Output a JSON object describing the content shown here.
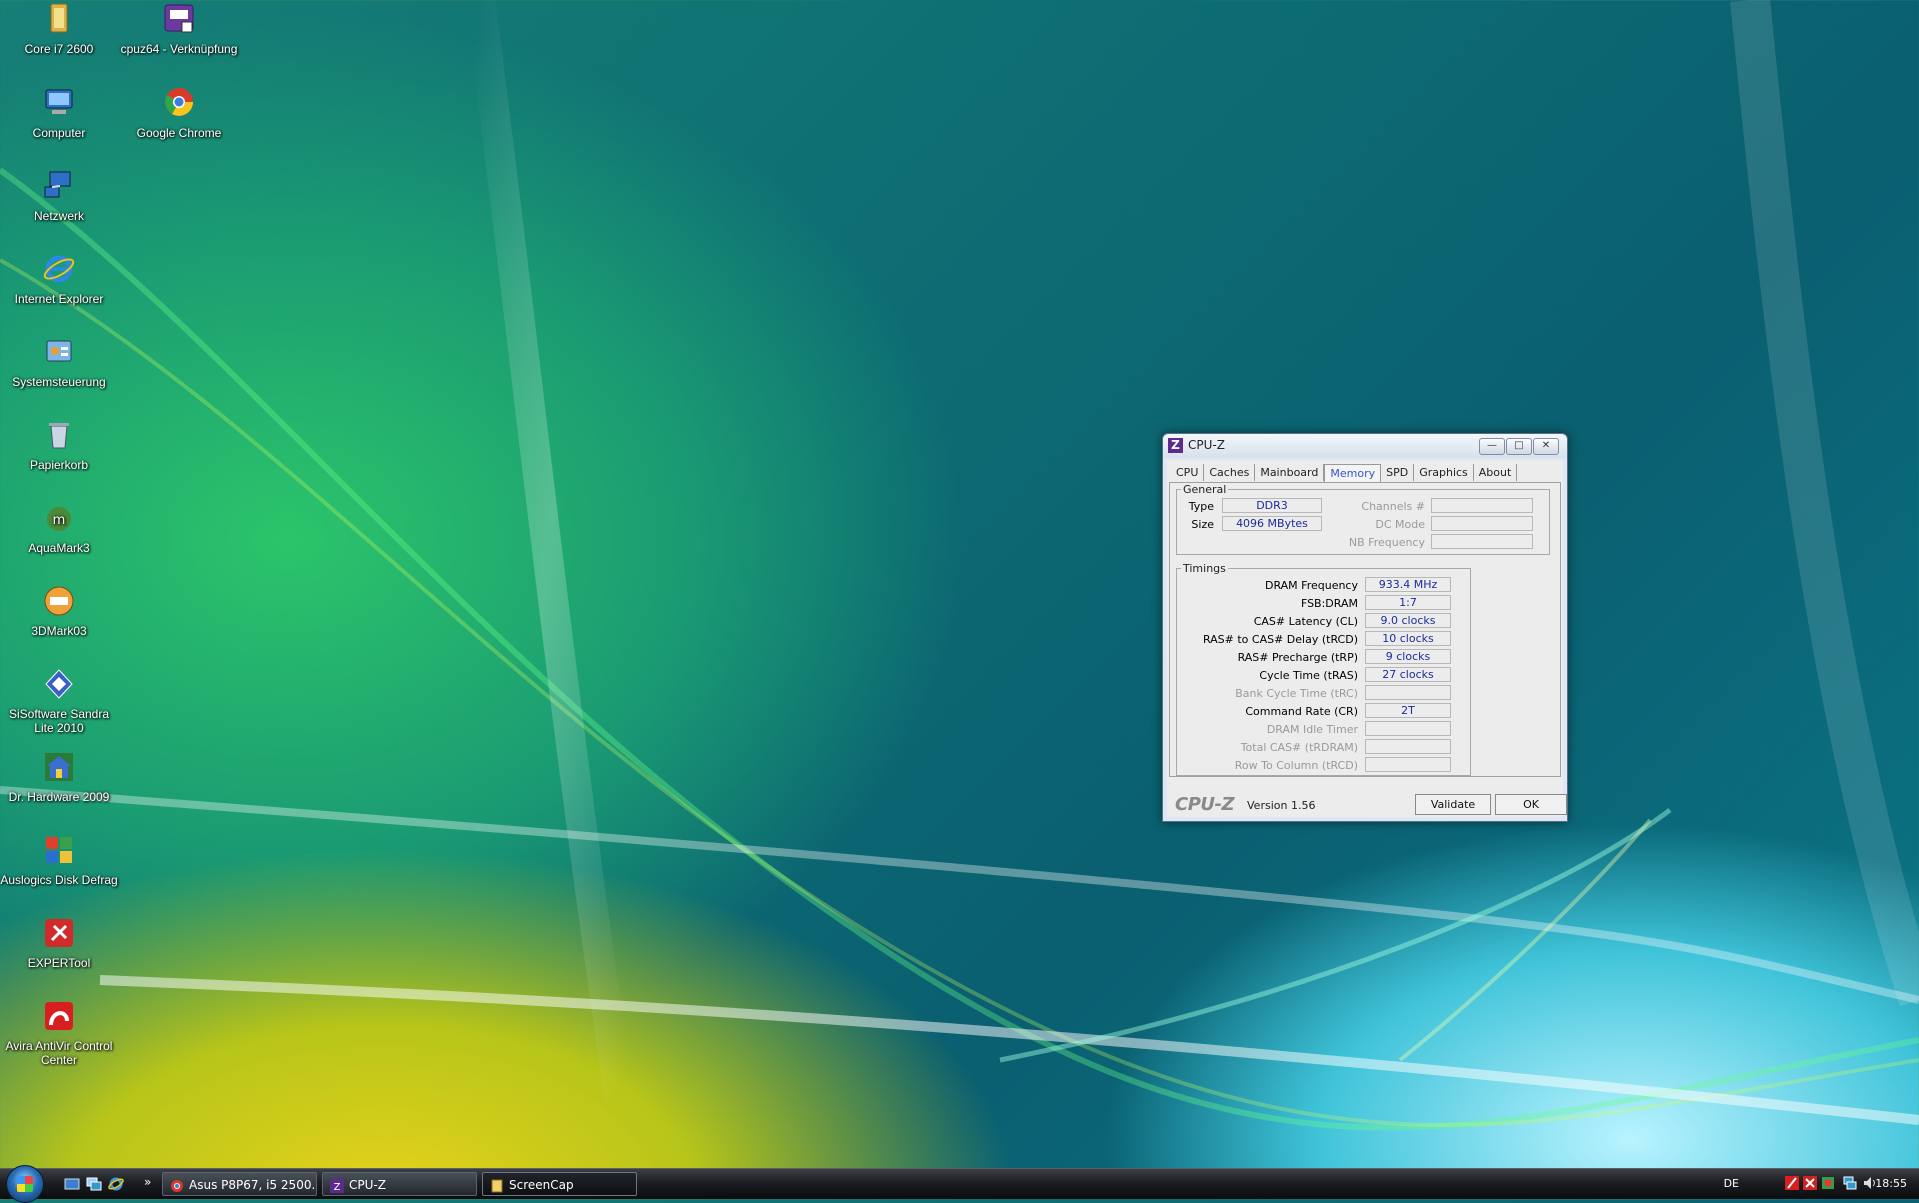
{
  "desktop": {
    "icons": [
      {
        "label": "Core i7 2600",
        "icon": "folder-icon"
      },
      {
        "label": "cpuz64 - Verknüpfung",
        "icon": "cpuz-shortcut-icon"
      },
      {
        "label": "Computer",
        "icon": "computer-icon"
      },
      {
        "label": "Google Chrome",
        "icon": "chrome-icon"
      },
      {
        "label": "Netzwerk",
        "icon": "network-icon"
      },
      {
        "label": "Internet Explorer",
        "icon": "ie-icon"
      },
      {
        "label": "Systemsteuerung",
        "icon": "control-panel-icon"
      },
      {
        "label": "Papierkorb",
        "icon": "recycle-bin-icon"
      },
      {
        "label": "AquaMark3",
        "icon": "aquamark-icon"
      },
      {
        "label": "3DMark03",
        "icon": "3dmark-icon"
      },
      {
        "label": "SiSoftware Sandra Lite 2010",
        "icon": "sandra-icon"
      },
      {
        "label": "Dr. Hardware 2009",
        "icon": "drhardware-icon"
      },
      {
        "label": "Auslogics Disk Defrag",
        "icon": "defrag-icon"
      },
      {
        "label": "EXPERTool",
        "icon": "expertool-icon"
      },
      {
        "label": "Avira AntiVir Control Center",
        "icon": "avira-icon"
      }
    ]
  },
  "window": {
    "title": "CPU-Z",
    "tabs": [
      "CPU",
      "Caches",
      "Mainboard",
      "Memory",
      "SPD",
      "Graphics",
      "About"
    ],
    "active_tab": "Memory",
    "general": {
      "legend": "General",
      "type_label": "Type",
      "type_value": "DDR3",
      "size_label": "Size",
      "size_value": "4096 MBytes",
      "channels_label": "Channels #",
      "channels_value": "",
      "dc_mode_label": "DC Mode",
      "dc_mode_value": "",
      "nb_freq_label": "NB Frequency",
      "nb_freq_value": ""
    },
    "timings": {
      "legend": "Timings",
      "rows": [
        {
          "label": "DRAM Frequency",
          "value": "933.4 MHz",
          "enabled": true
        },
        {
          "label": "FSB:DRAM",
          "value": "1:7",
          "enabled": true
        },
        {
          "label": "CAS# Latency (CL)",
          "value": "9.0 clocks",
          "enabled": true
        },
        {
          "label": "RAS# to CAS# Delay (tRCD)",
          "value": "10 clocks",
          "enabled": true
        },
        {
          "label": "RAS# Precharge (tRP)",
          "value": "9 clocks",
          "enabled": true
        },
        {
          "label": "Cycle Time (tRAS)",
          "value": "27 clocks",
          "enabled": true
        },
        {
          "label": "Bank Cycle Time (tRC)",
          "value": "",
          "enabled": false
        },
        {
          "label": "Command Rate (CR)",
          "value": "2T",
          "enabled": true
        },
        {
          "label": "DRAM Idle Timer",
          "value": "",
          "enabled": false
        },
        {
          "label": "Total CAS# (tRDRAM)",
          "value": "",
          "enabled": false
        },
        {
          "label": "Row To Column (tRCD)",
          "value": "",
          "enabled": false
        }
      ]
    },
    "footer": {
      "brand": "CPU-Z",
      "version": "Version 1.56",
      "validate_label": "Validate",
      "ok_label": "OK"
    }
  },
  "taskbar": {
    "tasks": [
      {
        "label": "Asus P8P67, i5 2500...",
        "icon": "chrome-icon"
      },
      {
        "label": "CPU-Z",
        "icon": "cpuz-icon"
      },
      {
        "label": "ScreenCap",
        "icon": "folder-icon"
      }
    ],
    "language": "DE",
    "clock": "18:55"
  }
}
